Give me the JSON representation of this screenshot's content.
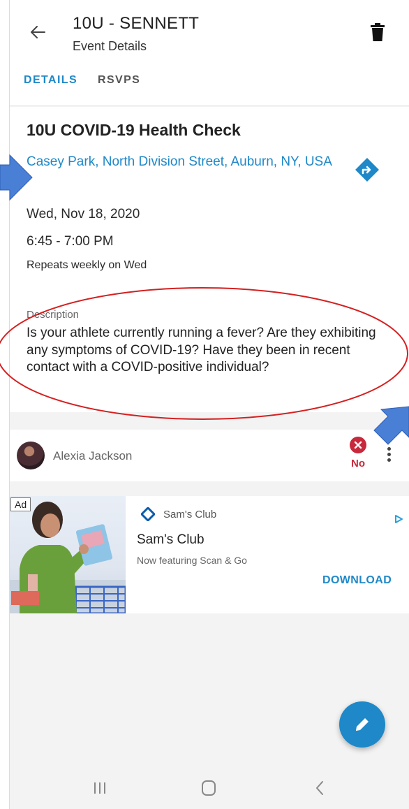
{
  "header": {
    "title": "10U - SENNETT",
    "subtitle": "Event Details"
  },
  "tabs": [
    {
      "label": "DETAILS",
      "selected": true
    },
    {
      "label": "RSVPS",
      "selected": false
    }
  ],
  "event": {
    "title": "10U COVID-19 Health Check",
    "location": "Casey Park, North Division Street, Auburn, NY, USA",
    "date": "Wed, Nov 18, 2020",
    "time": "6:45 - 7:00 PM",
    "repeats": "Repeats weekly on Wed",
    "description_label": "Description",
    "description": "Is your athlete currently running a fever? Are they exhibiting any symptoms of COVID-19? Have they been in recent contact with a COVID-positive individual?"
  },
  "rsvp": {
    "name": "Alexia Jackson",
    "status": "No",
    "status_color": "#c8283c"
  },
  "ad": {
    "badge": "Ad",
    "brand": "Sam's Club",
    "headline": "Sam's Club",
    "body": "Now featuring Scan & Go",
    "cta": "DOWNLOAD"
  },
  "colors": {
    "accent": "#1e88c8",
    "annotation_arrow": "#4a7fd6",
    "annotation_circle": "#d42020"
  },
  "icons": {
    "back": "arrow-left-icon",
    "delete": "trash-icon",
    "directions": "directions-icon",
    "edit": "pencil-icon"
  }
}
